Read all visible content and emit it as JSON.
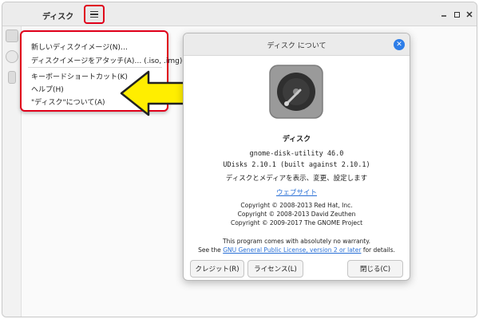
{
  "window": {
    "title": "ディスク"
  },
  "menu": {
    "items": [
      "新しいディスクイメージ(N)…",
      "ディスクイメージをアタッチ(A)… (.iso, .img)",
      "キーボードショートカット(K)",
      "ヘルプ(H)",
      "\"ディスク\"について(A)"
    ]
  },
  "about": {
    "title": "ディスク について",
    "app_name": "ディスク",
    "version": "gnome-disk-utility 46.0",
    "udisks": "UDisks 2.10.1 (built against 2.10.1)",
    "description": "ディスクとメディアを表示、変更、設定します",
    "website": "ウェブサイト",
    "copyrights": [
      "Copyright © 2008-2013 Red Hat, Inc.",
      "Copyright © 2008-2013 David Zeuthen",
      "Copyright © 2009-2017 The GNOME Project"
    ],
    "warranty_line1": "This program comes with absolutely no warranty.",
    "warranty_prefix": "See the ",
    "warranty_link": "GNU General Public License, version 2 or later",
    "warranty_suffix": " for details.",
    "buttons": {
      "credits": "クレジット(R)",
      "license": "ライセンス(L)",
      "close": "閉じる(C)"
    }
  },
  "colors": {
    "highlight": "#e0001a",
    "arrow": "#ffee00",
    "link": "#2a70d6",
    "close_button": "#2d7de8"
  },
  "icons": [
    "hamburger-menu-icon",
    "minimize-icon",
    "maximize-icon",
    "close-icon",
    "disk-utility-icon",
    "dialog-close-icon"
  ]
}
